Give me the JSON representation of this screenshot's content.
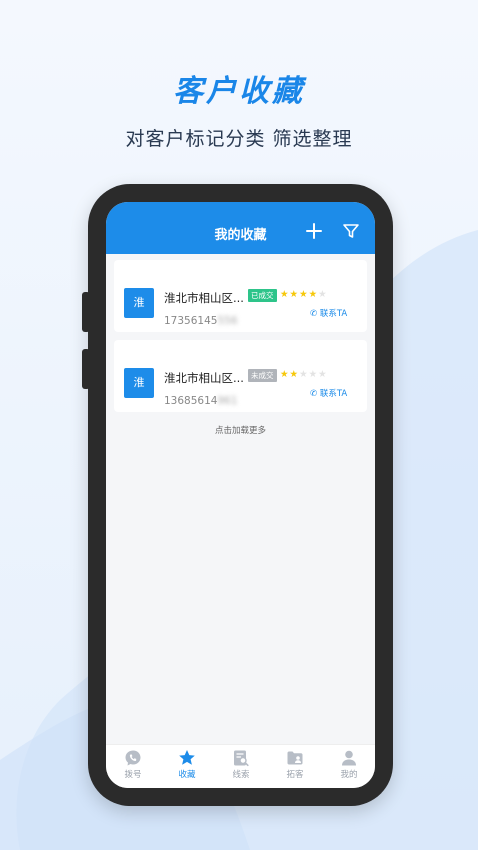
{
  "promo": {
    "headline": "客户收藏",
    "subline": "对客户标记分类 筛选整理"
  },
  "app": {
    "title": "我的收藏",
    "add_icon": "plus-icon",
    "filter_icon": "filter-icon",
    "load_more": "点击加载更多",
    "customers": [
      {
        "avatar": "淮",
        "name": "淮北市相山区...",
        "status": "已成交",
        "status_color": "#2ec48a",
        "rating": 4,
        "rating_max": 5,
        "contact_label": "联系TA",
        "phone_visible": "17356145",
        "phone_masked": "556"
      },
      {
        "avatar": "淮",
        "name": "淮北市相山区...",
        "status": "未成交",
        "status_color": "#b0b4ba",
        "rating": 2,
        "rating_max": 5,
        "contact_label": "联系TA",
        "phone_visible": "13685614",
        "phone_masked": "961"
      }
    ],
    "tabs": [
      {
        "label": "拨号",
        "icon": "dial-icon",
        "active": false
      },
      {
        "label": "收藏",
        "icon": "star-icon",
        "active": true
      },
      {
        "label": "线索",
        "icon": "clue-search-icon",
        "active": false
      },
      {
        "label": "拓客",
        "icon": "folder-user-icon",
        "active": false
      },
      {
        "label": "我的",
        "icon": "profile-icon",
        "active": false
      }
    ]
  },
  "colors": {
    "accent": "#1d8ce9",
    "headline": "#1a86e8",
    "star_on": "#f6c80a",
    "star_off": "#e3e3e3"
  }
}
